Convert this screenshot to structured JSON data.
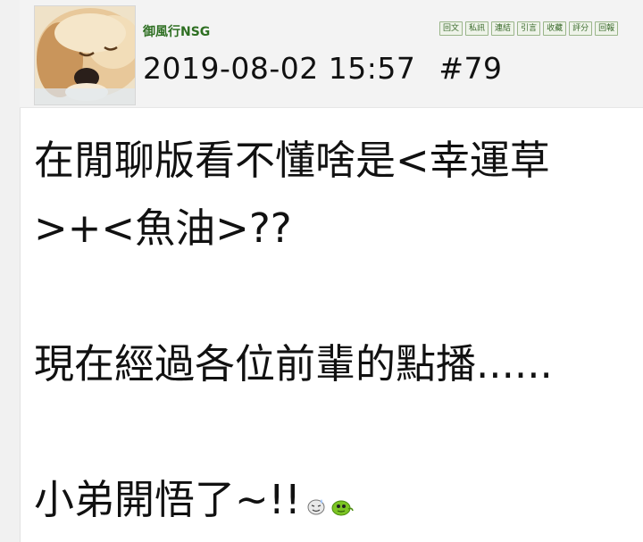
{
  "post": {
    "author": "御風行NSG",
    "timestamp": "2019-08-02 15:57",
    "post_number": "#79",
    "toolbar": [
      "回文",
      "私訊",
      "連結",
      "引言",
      "收藏",
      "評分",
      "回報"
    ]
  },
  "body": {
    "lines": [
      "在閒聊版看不懂啥是<幸運草",
      ">+<魚油>??",
      "",
      "現在經過各位前輩的點播......",
      "",
      "小弟開悟了~!!"
    ]
  },
  "emoticons": [
    "sweat-face-emoticon",
    "green-blob-emoticon"
  ],
  "colors": {
    "author": "#2e6f22",
    "button_border": "#9ab58a",
    "header_bg": "#f3f3f3"
  }
}
